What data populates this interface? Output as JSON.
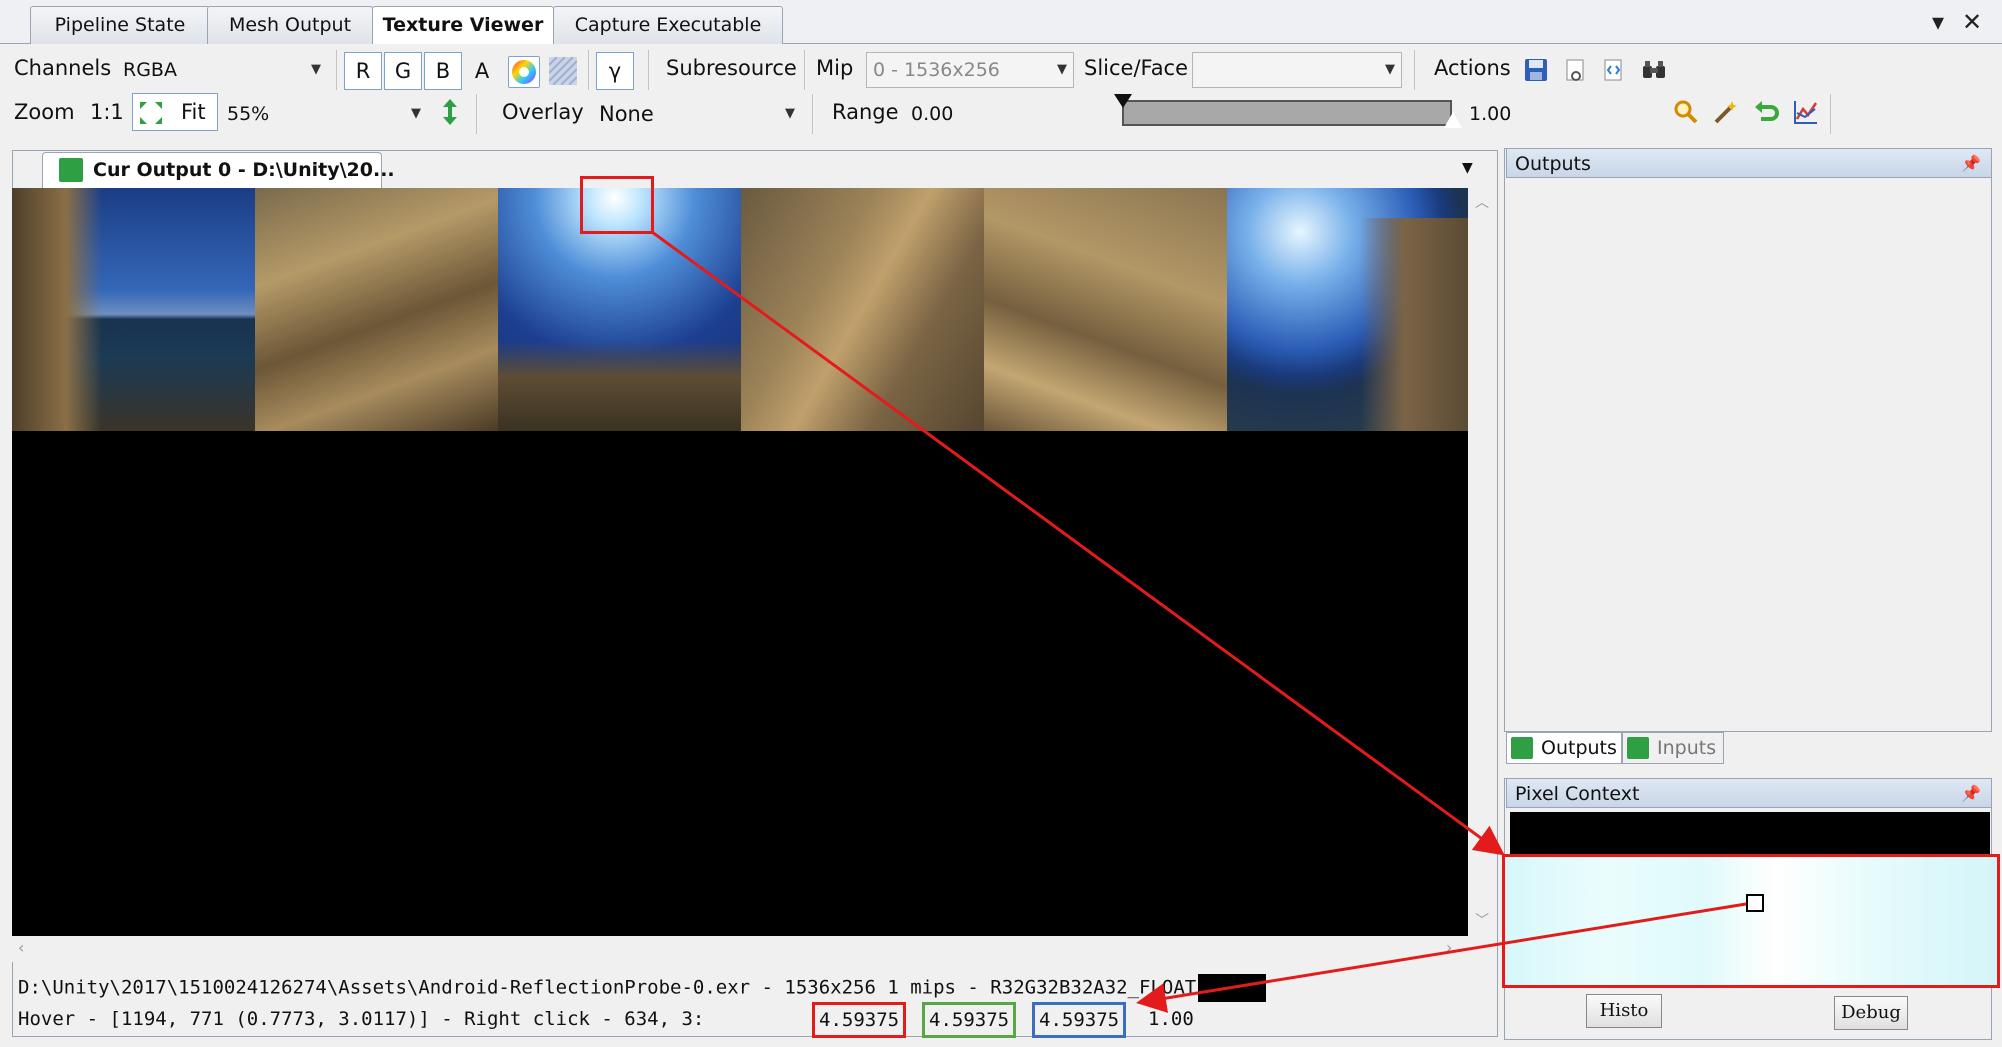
{
  "main_tabs": [
    {
      "label": "Pipeline State"
    },
    {
      "label": "Mesh Output"
    },
    {
      "label": "Texture Viewer"
    },
    {
      "label": "Capture Executable"
    }
  ],
  "window_controls": {
    "dropdown": "▾",
    "close": "✕"
  },
  "toolbar": {
    "channels_label": "Channels",
    "channels_value": "RGBA",
    "r": "R",
    "g": "G",
    "b": "B",
    "a": "A",
    "gamma": "γ",
    "subresource_label": "Subresource",
    "mip_label": "Mip",
    "mip_value": "0 - 1536x256",
    "slice_label": "Slice/Face",
    "slice_value": "",
    "actions_label": "Actions",
    "zoom_label": "Zoom",
    "zoom_1to1": "1:1",
    "fit_label": "Fit",
    "zoom_value": "55%",
    "overlay_label": "Overlay",
    "overlay_value": "None",
    "range_label": "Range",
    "range_min": "0.00",
    "range_max": "1.00"
  },
  "viewer": {
    "tab_title": "Cur Output 0 - D:\\Unity\\20...",
    "status_line1": "D:\\Unity\\2017\\1510024126274\\Assets\\Android-ReflectionProbe-0.exr - 1536x256 1 mips - R32G32B32A32_FLOAT",
    "status_line2_prefix": "Hover - [1194,  771 (0.7773, 3.0117)] - Right click -   634,    3:",
    "val_r": "4.59375",
    "val_g": "4.59375",
    "val_b": "4.59375",
    "val_a": "1.00"
  },
  "right_panel": {
    "outputs_title": "Outputs",
    "tab_outputs": "Outputs",
    "tab_inputs": "Inputs",
    "pixel_context_title": "Pixel Context",
    "histo_button": "Histo",
    "debug_button": "Debug"
  },
  "colors": {
    "highlight_red": "#e31b1b",
    "highlight_green": "#5aa545",
    "highlight_blue": "#3a6fc0",
    "accent_blue": "#7da2ce",
    "pixel_context_fill": "#e2fbfc"
  }
}
